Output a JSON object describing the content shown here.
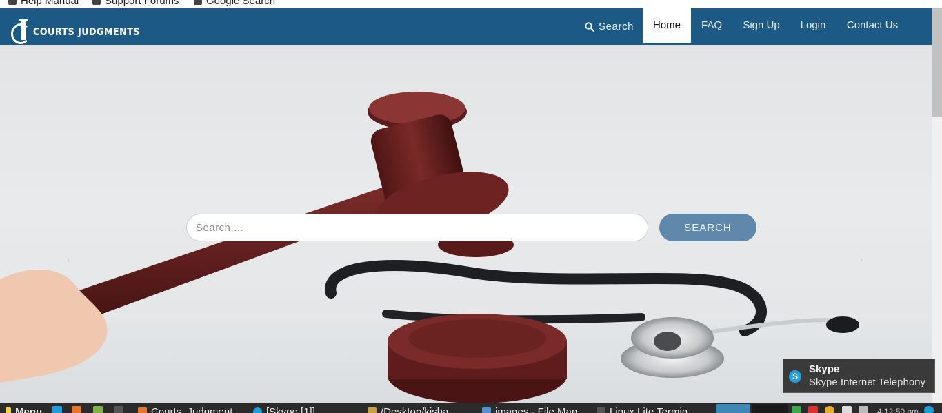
{
  "bookmarks": [
    "Help Manual",
    "Support Forums",
    "Google Search"
  ],
  "site": {
    "logo_text": "COURTS JUDGMENTS",
    "nav": {
      "search": "Search",
      "home": "Home",
      "faq": "FAQ",
      "signup": "Sign Up",
      "login": "Login",
      "contact": "Contact Us"
    },
    "colors": {
      "navbar": "#1c5a85",
      "search_button": "#5f88aa"
    }
  },
  "hero": {
    "search_placeholder": "Search....",
    "search_value": "",
    "search_button": "SEARCH",
    "prev_arrow": "‹",
    "next_arrow": "›"
  },
  "notification": {
    "icon_letter": "S",
    "title": "Skype",
    "body": "Skype Internet Telephony"
  },
  "taskbar": {
    "menu": "Menu",
    "tasks": [
      "Courts_Judgment",
      "[Skype [1]]",
      "/Desktop/kisha",
      "images - File Man",
      "Linux Lite Termin"
    ],
    "clock": "4:12:50 pm"
  }
}
